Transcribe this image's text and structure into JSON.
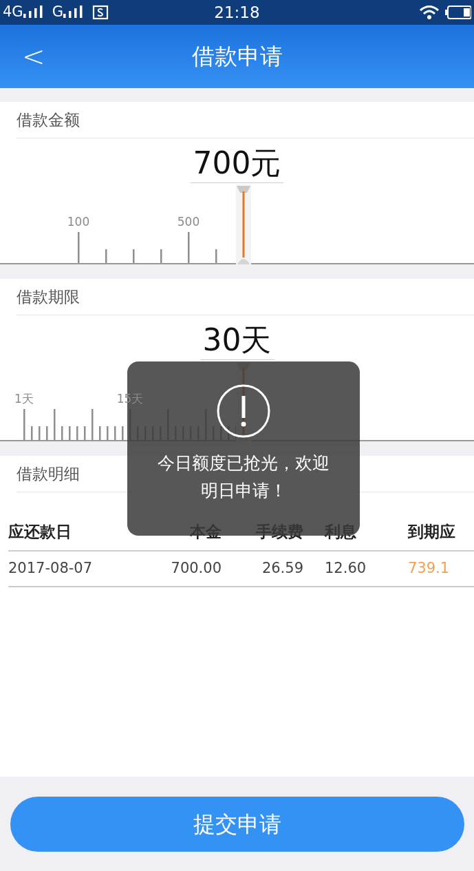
{
  "status_bar": {
    "network_1": "4G",
    "network_2": "G",
    "time": "21:18"
  },
  "header": {
    "back": "<",
    "title": "借款申请"
  },
  "amount": {
    "label": "借款金额",
    "value": "700元",
    "tick_labels": [
      "100",
      "500"
    ]
  },
  "term": {
    "label": "借款期限",
    "value": "30天",
    "tick_labels": [
      "1天",
      "15天"
    ]
  },
  "detail": {
    "label": "借款明细",
    "columns": [
      "应还款日",
      "本金",
      "手续费",
      "利息",
      "到期应"
    ],
    "rows": [
      [
        "2017-08-07",
        "700.00",
        "26.59",
        "12.60",
        "739.1"
      ]
    ]
  },
  "toast": {
    "text": "今日额度已抢光，欢迎明日申请！"
  },
  "submit": "提交申请"
}
